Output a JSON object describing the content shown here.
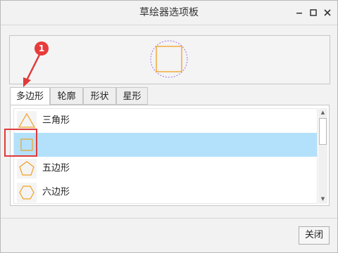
{
  "window": {
    "title": "草绘器选项板",
    "minimize_icon": "minimize-icon",
    "maximize_icon": "maximize-icon",
    "close_icon": "close-icon"
  },
  "preview": {
    "shape": "square-icon",
    "accent": "#f0a020",
    "outline": "#a070e0"
  },
  "tabs": [
    {
      "label": "多边形",
      "active": true
    },
    {
      "label": "轮廓",
      "active": false
    },
    {
      "label": "形状",
      "active": false
    },
    {
      "label": "星形",
      "active": false
    }
  ],
  "list": {
    "items": [
      {
        "label": "三角形",
        "icon": "triangle-icon",
        "selected": false
      },
      {
        "label": "",
        "icon": "square-icon",
        "selected": true
      },
      {
        "label": "五边形",
        "icon": "pentagon-icon",
        "selected": false
      },
      {
        "label": "六边形",
        "icon": "hexagon-icon",
        "selected": false
      }
    ]
  },
  "footer": {
    "close_label": "关闭"
  },
  "annotation": {
    "badge": "1",
    "color": "#e83b3b"
  }
}
